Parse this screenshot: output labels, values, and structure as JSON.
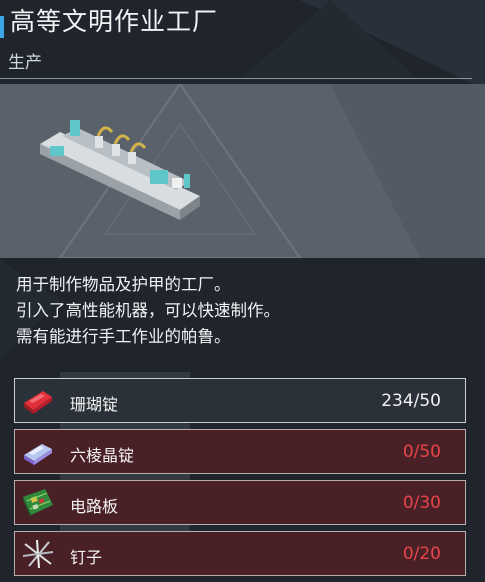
{
  "header": {
    "title": "高等文明作业工厂",
    "category": "生产"
  },
  "preview": {
    "icon": "production-line-machine-icon"
  },
  "description": [
    "用于制作物品及护甲的工厂。",
    "引入了高性能机器，可以快速制作。",
    "需有能进行手工作业的帕鲁。"
  ],
  "materials": [
    {
      "name": "珊瑚锭",
      "have": "234",
      "need": "50",
      "qty": "234/50",
      "sufficient": true,
      "icon": "coral-ingot-icon"
    },
    {
      "name": "六棱晶锭",
      "have": "0",
      "need": "50",
      "qty": "0/50",
      "sufficient": false,
      "icon": "hexolite-ingot-icon"
    },
    {
      "name": "电路板",
      "have": "0",
      "need": "30",
      "qty": "0/30",
      "sufficient": false,
      "icon": "circuit-board-icon"
    },
    {
      "name": "钉子",
      "have": "0",
      "need": "20",
      "qty": "0/20",
      "sufficient": false,
      "icon": "nail-icon"
    }
  ],
  "colors": {
    "accent": "#3aa6e8",
    "shortage": "#e6454a",
    "sufficient": "#f2f2f2"
  }
}
